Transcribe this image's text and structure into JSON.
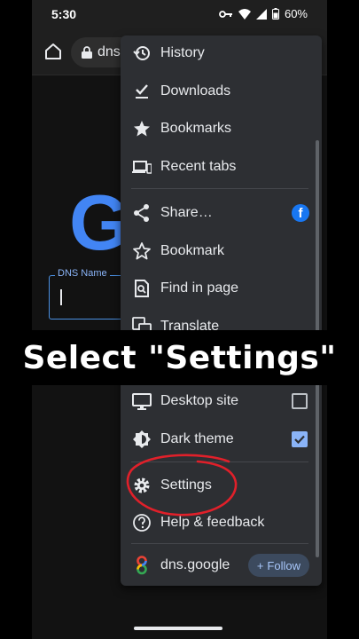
{
  "status_bar": {
    "time": "5:30",
    "battery": "60%"
  },
  "url_bar": {
    "url_text": "dns"
  },
  "page": {
    "logo_letter": "G",
    "dns_field_label": "DNS Name"
  },
  "menu": {
    "items": [
      {
        "label": "History"
      },
      {
        "label": "Downloads"
      },
      {
        "label": "Bookmarks"
      },
      {
        "label": "Recent tabs"
      },
      {
        "label": "Share…"
      },
      {
        "label": "Bookmark"
      },
      {
        "label": "Find in page"
      },
      {
        "label": "Translate"
      },
      {
        "label": "Desktop site",
        "checked": false
      },
      {
        "label": "Dark theme",
        "checked": true
      },
      {
        "label": "Settings"
      },
      {
        "label": "Help & feedback"
      }
    ],
    "footer": {
      "site": "dns.google",
      "follow_label": "Follow"
    }
  },
  "overlay": {
    "caption": "Select \"Settings\""
  },
  "colors": {
    "accent": "#8ab4f8",
    "annotation": "#e0202a",
    "menu_bg": "#2d2f33"
  }
}
